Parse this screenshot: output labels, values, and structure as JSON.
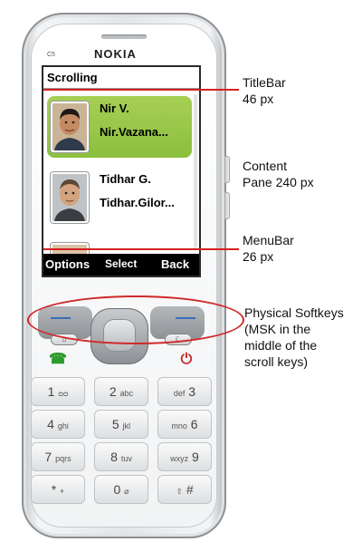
{
  "device": {
    "brand": "NOKIA",
    "model": "C5"
  },
  "screen": {
    "title": "Scrolling",
    "contacts": [
      {
        "name": "Nir V.",
        "email": "Nir.Vazana...",
        "highlighted": true
      },
      {
        "name": "Tidhar G.",
        "email": "Tidhar.Gilor...",
        "highlighted": false
      }
    ],
    "softkeys": {
      "left": "Options",
      "middle": "Select",
      "right": "Back"
    }
  },
  "keypad": {
    "keys": [
      {
        "main": "1",
        "sub": "ᴑᴑ"
      },
      {
        "main": "2",
        "sub": "abc"
      },
      {
        "main": "3",
        "sub": "def"
      },
      {
        "main": "4",
        "sub": "ghi"
      },
      {
        "main": "5",
        "sub": "jkl"
      },
      {
        "main": "6",
        "sub": "mno"
      },
      {
        "main": "7",
        "sub": "pqrs"
      },
      {
        "main": "8",
        "sub": "tuv"
      },
      {
        "main": "9",
        "sub": "wxyz"
      },
      {
        "main": "*",
        "sub": "+"
      },
      {
        "main": "0",
        "sub": "⌀"
      },
      {
        "main": "#",
        "sub": "⇧"
      }
    ],
    "home_key_icon": "home-icon",
    "clear_key_icon": "clear-icon",
    "call_icon": "call-icon",
    "end_icon": "end-call-icon"
  },
  "annotations": {
    "titlebar": [
      "TitleBar",
      "46 px"
    ],
    "content": [
      "Content",
      "Pane 240 px"
    ],
    "menubar": [
      "MenuBar",
      "26  px"
    ],
    "softkeys": [
      "Physical Softkeys",
      "(MSK in the",
      "middle of the",
      "scroll keys)"
    ]
  },
  "colors": {
    "highlight": "#96c44a",
    "annotation": "#d62020",
    "softkey_dash": "#3b6cb8"
  }
}
